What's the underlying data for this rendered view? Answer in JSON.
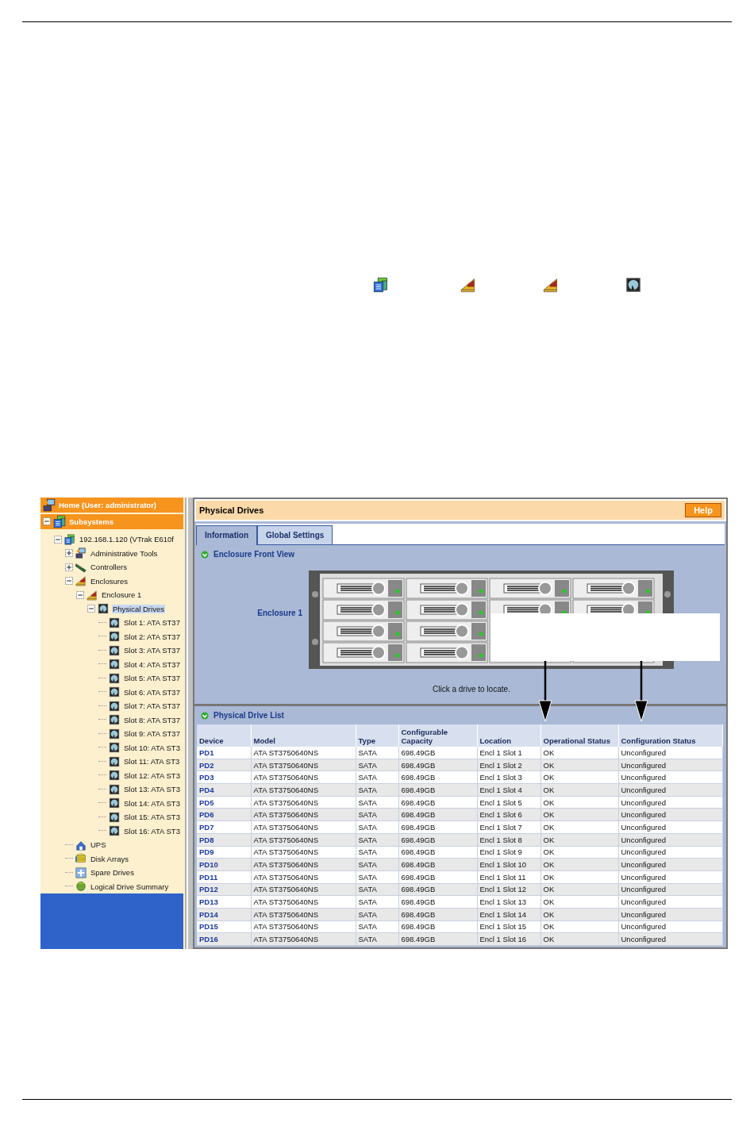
{
  "legend_icons": [
    {
      "kind": "server"
    },
    {
      "kind": "enclosure"
    },
    {
      "kind": "enclosure"
    },
    {
      "kind": "drive"
    }
  ],
  "sidebar": {
    "home": {
      "label": "Home (User: administrator)"
    },
    "subsystems": {
      "label": "Subsystems",
      "expanded": true
    },
    "tree": [
      {
        "label": "192.168.1.120 (VTrak E610f",
        "kind": "server",
        "expanded": true,
        "selected": false,
        "children": [
          {
            "label": "Administrative Tools",
            "kind": "tools",
            "expanded": false,
            "selected": false
          },
          {
            "label": "Controllers",
            "kind": "controller",
            "expanded": false,
            "selected": false
          },
          {
            "label": "Enclosures",
            "kind": "enclosure",
            "expanded": true,
            "selected": false,
            "children": [
              {
                "label": "Enclosure 1",
                "kind": "enclosure",
                "expanded": true,
                "selected": false,
                "children": [
                  {
                    "label": "Physical Drives",
                    "kind": "drive",
                    "expanded": true,
                    "selected": true,
                    "children": [
                      {
                        "label": "Slot 1: ATA ST37",
                        "kind": "drive",
                        "selected": false
                      },
                      {
                        "label": "Slot 2: ATA ST37",
                        "kind": "drive",
                        "selected": false
                      },
                      {
                        "label": "Slot 3: ATA ST37",
                        "kind": "drive",
                        "selected": false
                      },
                      {
                        "label": "Slot 4: ATA ST37",
                        "kind": "drive",
                        "selected": false
                      },
                      {
                        "label": "Slot 5: ATA ST37",
                        "kind": "drive",
                        "selected": false
                      },
                      {
                        "label": "Slot 6: ATA ST37",
                        "kind": "drive",
                        "selected": false
                      },
                      {
                        "label": "Slot 7: ATA ST37",
                        "kind": "drive",
                        "selected": false
                      },
                      {
                        "label": "Slot 8: ATA ST37",
                        "kind": "drive",
                        "selected": false
                      },
                      {
                        "label": "Slot 9: ATA ST37",
                        "kind": "drive",
                        "selected": false
                      },
                      {
                        "label": "Slot 10: ATA ST3",
                        "kind": "drive",
                        "selected": false
                      },
                      {
                        "label": "Slot 11: ATA ST3",
                        "kind": "drive",
                        "selected": false
                      },
                      {
                        "label": "Slot 12: ATA ST3",
                        "kind": "drive",
                        "selected": false
                      },
                      {
                        "label": "Slot 13: ATA ST3",
                        "kind": "drive",
                        "selected": false
                      },
                      {
                        "label": "Slot 14: ATA ST3",
                        "kind": "drive",
                        "selected": false
                      },
                      {
                        "label": "Slot 15: ATA ST3",
                        "kind": "drive",
                        "selected": false
                      },
                      {
                        "label": "Slot 16: ATA ST3",
                        "kind": "drive",
                        "selected": false
                      }
                    ]
                  }
                ]
              }
            ]
          },
          {
            "label": "UPS",
            "kind": "ups",
            "selected": false
          },
          {
            "label": "Disk Arrays",
            "kind": "array",
            "selected": false
          },
          {
            "label": "Spare Drives",
            "kind": "spare",
            "selected": false
          },
          {
            "label": "Logical Drive Summary",
            "kind": "logical",
            "selected": false
          }
        ]
      }
    ]
  },
  "panel": {
    "title": "Physical Drives",
    "help_button": "Help",
    "tabs": [
      {
        "label": "Information",
        "selected": true
      },
      {
        "label": "Global Settings",
        "selected": false
      }
    ],
    "front_view": {
      "title": "Enclosure Front View",
      "enclosure_label": "Enclosure 1",
      "hint": "Click a drive to locate."
    },
    "drive_list": {
      "title": "Physical Drive List",
      "columns": [
        "Device",
        "Model",
        "Type",
        "Configurable Capacity",
        "Location",
        "Operational Status",
        "Configuration Status"
      ],
      "rows": [
        [
          "PD1",
          "ATA ST3750640NS",
          "SATA",
          "698.49GB",
          "Encl 1 Slot 1",
          "OK",
          "Unconfigured"
        ],
        [
          "PD2",
          "ATA ST3750640NS",
          "SATA",
          "698.49GB",
          "Encl 1 Slot 2",
          "OK",
          "Unconfigured"
        ],
        [
          "PD3",
          "ATA ST3750640NS",
          "SATA",
          "698.49GB",
          "Encl 1 Slot 3",
          "OK",
          "Unconfigured"
        ],
        [
          "PD4",
          "ATA ST3750640NS",
          "SATA",
          "698.49GB",
          "Encl 1 Slot 4",
          "OK",
          "Unconfigured"
        ],
        [
          "PD5",
          "ATA ST3750640NS",
          "SATA",
          "698.49GB",
          "Encl 1 Slot 5",
          "OK",
          "Unconfigured"
        ],
        [
          "PD6",
          "ATA ST3750640NS",
          "SATA",
          "698.49GB",
          "Encl 1 Slot 6",
          "OK",
          "Unconfigured"
        ],
        [
          "PD7",
          "ATA ST3750640NS",
          "SATA",
          "698.49GB",
          "Encl 1 Slot 7",
          "OK",
          "Unconfigured"
        ],
        [
          "PD8",
          "ATA ST3750640NS",
          "SATA",
          "698.49GB",
          "Encl 1 Slot 8",
          "OK",
          "Unconfigured"
        ],
        [
          "PD9",
          "ATA ST3750640NS",
          "SATA",
          "698.49GB",
          "Encl 1 Slot 9",
          "OK",
          "Unconfigured"
        ],
        [
          "PD10",
          "ATA ST3750640NS",
          "SATA",
          "698.49GB",
          "Encl 1 Slot 10",
          "OK",
          "Unconfigured"
        ],
        [
          "PD11",
          "ATA ST3750640NS",
          "SATA",
          "698.49GB",
          "Encl 1 Slot 11",
          "OK",
          "Unconfigured"
        ],
        [
          "PD12",
          "ATA ST3750640NS",
          "SATA",
          "698.49GB",
          "Encl 1 Slot 12",
          "OK",
          "Unconfigured"
        ],
        [
          "PD13",
          "ATA ST3750640NS",
          "SATA",
          "698.49GB",
          "Encl 1 Slot 13",
          "OK",
          "Unconfigured"
        ],
        [
          "PD14",
          "ATA ST3750640NS",
          "SATA",
          "698.49GB",
          "Encl 1 Slot 14",
          "OK",
          "Unconfigured"
        ],
        [
          "PD15",
          "ATA ST3750640NS",
          "SATA",
          "698.49GB",
          "Encl 1 Slot 15",
          "OK",
          "Unconfigured"
        ],
        [
          "PD16",
          "ATA ST3750640NS",
          "SATA",
          "698.49GB",
          "Encl 1 Slot 16",
          "OK",
          "Unconfigured"
        ]
      ]
    }
  }
}
